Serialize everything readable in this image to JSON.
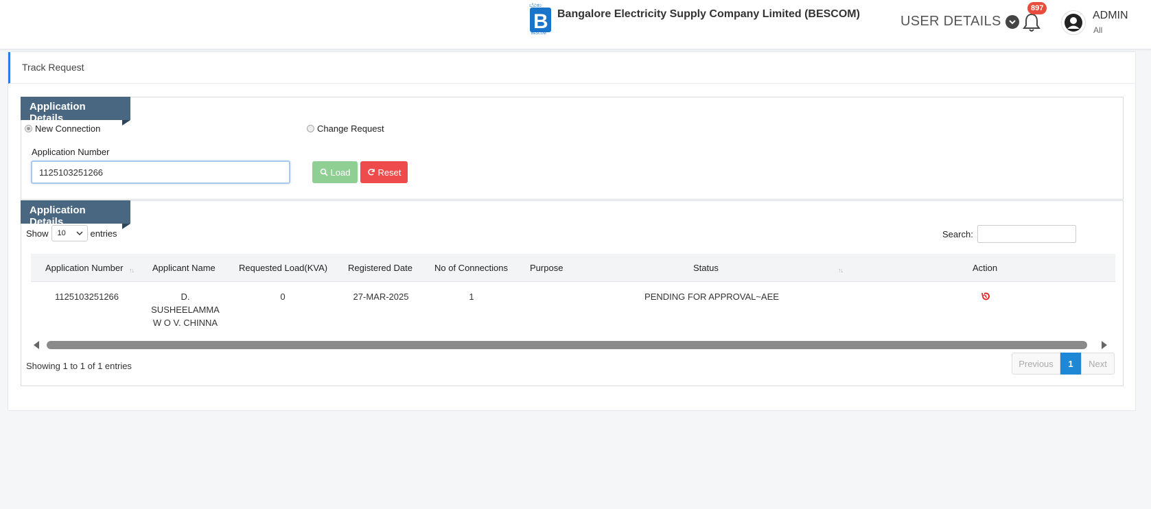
{
  "header": {
    "company": "Bangalore Electricity Supply Company Limited (BESCOM)",
    "user_details": "USER DETAILS",
    "notification_count": "897",
    "user_name": "ADMIN",
    "user_role": "All"
  },
  "page": {
    "title": "Track Request"
  },
  "search_panel": {
    "heading": "Application Details",
    "radio_new": "New Connection",
    "radio_change": "Change Request",
    "app_number_label": "Application Number",
    "app_number_value": "1125103251266",
    "load_label": "Load",
    "reset_label": "Reset"
  },
  "results_panel": {
    "heading": "Application Details",
    "show_label": "Show",
    "entries_value": "10",
    "entries_label": "entries",
    "search_label": "Search:",
    "columns": [
      "Application Number",
      "Applicant Name",
      "Requested Load(KVA)",
      "Registered Date",
      "No of Connections",
      "Purpose",
      "Status",
      "Action"
    ],
    "rows": [
      {
        "app_number": "1125103251266",
        "applicant_line1": "D.",
        "applicant_line2": "SUSHEELAMMA",
        "applicant_line3": "W O V. CHINNA",
        "requested_load": "0",
        "registered_date": "27-MAR-2025",
        "connections": "1",
        "purpose": "",
        "status": "PENDING FOR APPROVAL~AEE"
      }
    ],
    "info": "Showing 1 to 1 of 1 entries",
    "pager": {
      "previous": "Previous",
      "current": "1",
      "next": "Next"
    }
  },
  "colors": {
    "ribbon": "#4a6782",
    "load_button": "#8fcf93",
    "reset_button": "#ee4c4c",
    "badge": "#e74c3c",
    "pager_active": "#1e88d6",
    "action_icon": "#e02020"
  },
  "icons": [
    "bescom-logo-icon",
    "chevron-down-icon",
    "bell-icon",
    "user-avatar-icon",
    "search-icon",
    "refresh-icon",
    "history-icon"
  ]
}
